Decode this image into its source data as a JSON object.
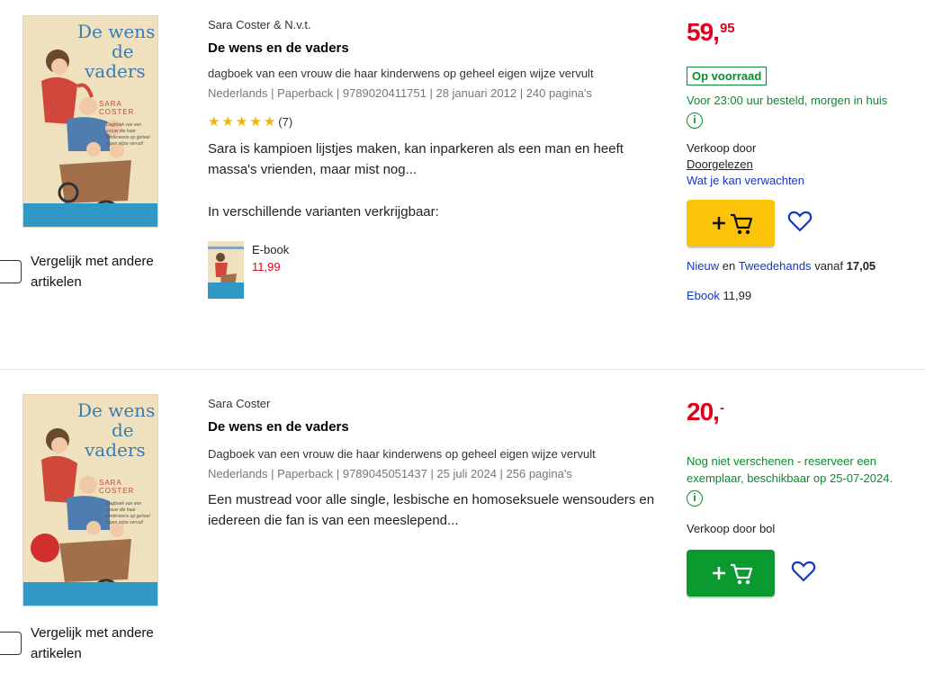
{
  "products": [
    {
      "cover": {
        "title_line1": "De wens",
        "title_line2": "de",
        "title_line3": "vaders",
        "author": "SARA COSTER",
        "blurb": "Dagboek van een vrouw die haar kinderwens op geheel eigen wijze vervult"
      },
      "compare_label": "Vergelijk met andere artikelen",
      "author": "Sara Coster & N.v.t.",
      "title": "De wens en de vaders",
      "subtitle": "dagboek van een vrouw die haar kinderwens op geheel eigen wijze vervult",
      "meta": "Nederlands | Paperback | 9789020411751 | 28 januari 2012 | 240 pagina's",
      "rating": {
        "stars": 5,
        "count": "(7)"
      },
      "description": "Sara is kampioen lijstjes maken, kan inparkeren als een man en heeft massa's vrienden, maar mist nog...",
      "variants_label": "In verschillende varianten verkrijgbaar:",
      "variant": {
        "type": "E-book",
        "price": "11,99"
      },
      "price_main": "59,",
      "price_cents": "95",
      "stock": "Op voorraad",
      "delivery": "Voor 23:00 uur besteld, morgen in huis",
      "info_icon": "i",
      "seller_label": "Verkoop door",
      "seller_name": "Doorgelezen",
      "expect_link": "Wat je kan verwachten",
      "offer": {
        "new": "Nieuw",
        "and": "en",
        "used": "Tweedehands",
        "from": "vanaf",
        "price": "17,05"
      },
      "ebook": {
        "label": "Ebook",
        "price": "11,99"
      },
      "cart_color": "#fcc30b"
    },
    {
      "cover": {
        "title_line1": "De wens",
        "title_line2": "de",
        "title_line3": "vaders",
        "author": "SARA COSTER",
        "blurb": "Dagboek van een vrouw die haar kinderwens op geheel eigen wijze vervult"
      },
      "compare_label": "Vergelijk met andere artikelen",
      "author": "Sara Coster",
      "title": "De wens en de vaders",
      "subtitle": "Dagboek van een vrouw die haar kinderwens op geheel eigen wijze vervult",
      "meta": "Nederlands | Paperback | 9789045051437 | 25 juli 2024 | 256 pagina's",
      "description": "Een mustread voor alle single, lesbische en homoseksuele wensouders en iedereen die fan is van een meeslepend...",
      "price_main": "20,",
      "price_cents": "-",
      "reserve": "Nog niet verschenen - reserveer een exemplaar, beschikbaar op 25-07-2024.",
      "info_icon": "i",
      "seller_label": "Verkoop door bol",
      "cart_color": "#0b9a2f"
    }
  ],
  "colors": {
    "price": "#e0001b",
    "stock_green": "#0b8a2f",
    "link_blue": "#1737bd"
  },
  "icons": {
    "cart": "shopping-cart-icon",
    "heart": "heart-icon",
    "plus": "plus-icon",
    "info": "info-icon",
    "star": "star-icon"
  }
}
